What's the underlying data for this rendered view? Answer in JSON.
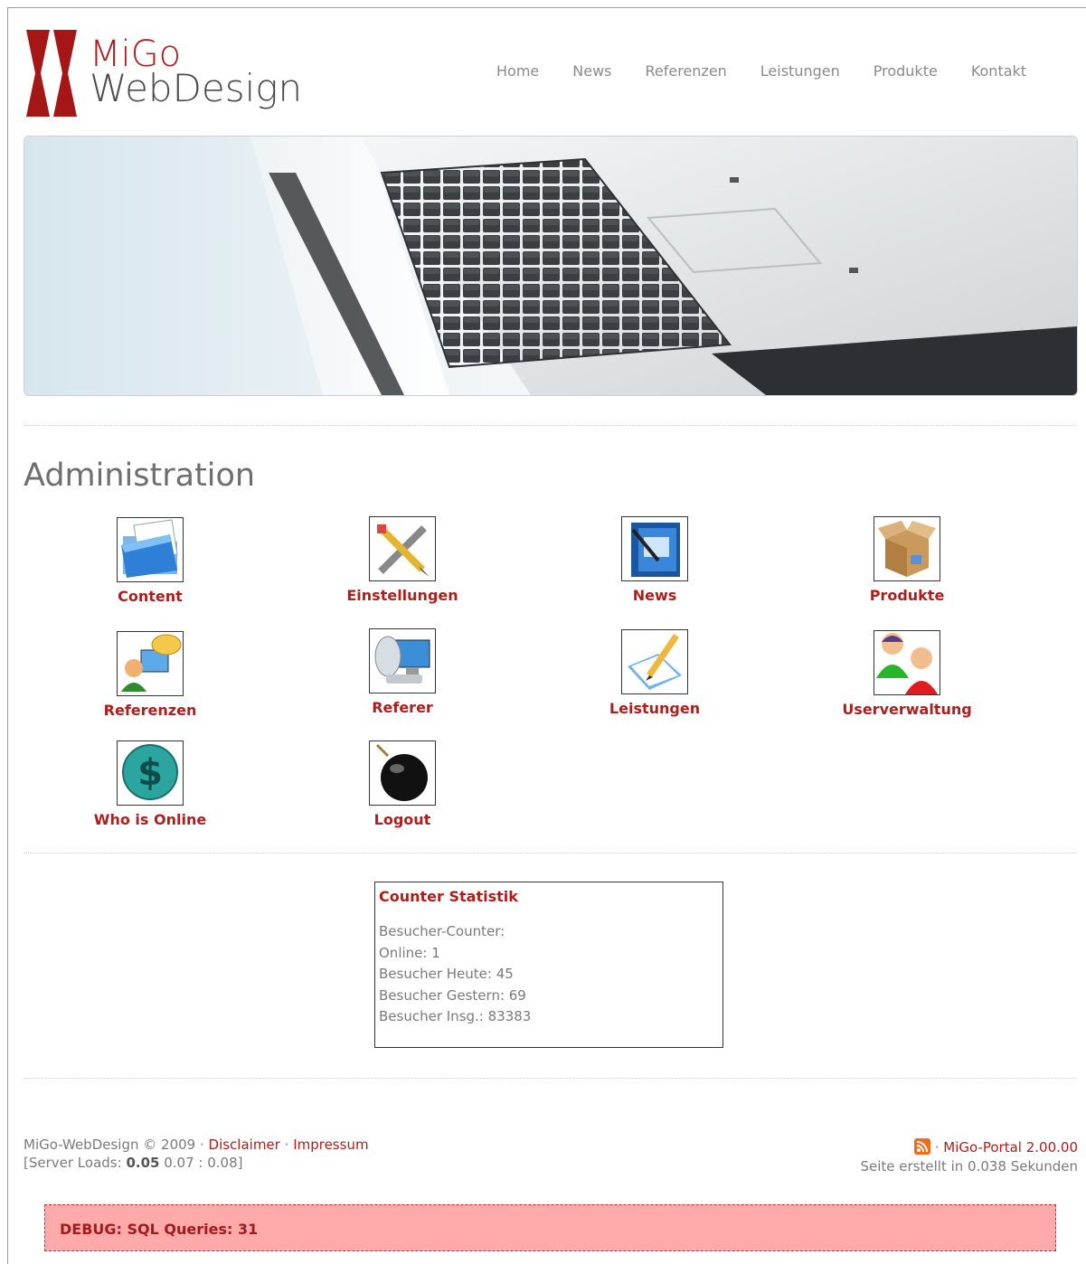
{
  "brand": {
    "line1": "MiGo",
    "line2": "WebDesign"
  },
  "nav": [
    "Home",
    "News",
    "Referenzen",
    "Leistungen",
    "Produkte",
    "Kontakt"
  ],
  "admin": {
    "title": "Administration",
    "tiles": [
      {
        "label": "Content",
        "icon": "folder-icon"
      },
      {
        "label": "Einstellungen",
        "icon": "tools-icon"
      },
      {
        "label": "News",
        "icon": "book-icon"
      },
      {
        "label": "Produkte",
        "icon": "box-icon"
      },
      {
        "label": "Referenzen",
        "icon": "user-chat-icon"
      },
      {
        "label": "Referer",
        "icon": "computer-icon"
      },
      {
        "label": "Leistungen",
        "icon": "pen-paper-icon"
      },
      {
        "label": "Userverwaltung",
        "icon": "users-icon"
      },
      {
        "label": "Who is Online",
        "icon": "dollar-icon"
      },
      {
        "label": "Logout",
        "icon": "bomb-icon"
      }
    ]
  },
  "counter": {
    "title": "Counter Statistik",
    "rows": [
      "Besucher-Counter:",
      "Online: 1",
      "Besucher Heute: 45",
      "Besucher Gestern: 69",
      "Besucher Insg.: 83383"
    ]
  },
  "footer": {
    "copyright": "MiGo-WebDesign  © 2009 ·",
    "disclaimer": "Disclaimer",
    "sep": "·",
    "impressum": "Impressum",
    "loads_prefix": "[Server Loads:",
    "load1": "0.05",
    "loads_rest": "0.07 : 0.08]",
    "portal_sep": "·",
    "portal": "MiGo-Portal 2.00.00",
    "generated": "Seite erstellt in 0.038 Sekunden"
  },
  "debug": "DEBUG: SQL Queries: 31",
  "colors": {
    "accent": "#b01d1d",
    "debug_bg": "#ffaaaa"
  }
}
